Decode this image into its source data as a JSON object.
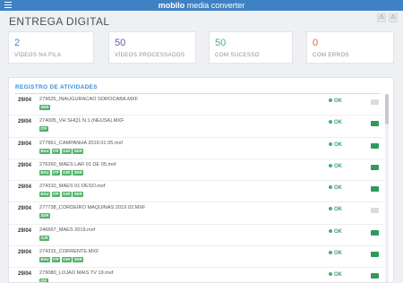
{
  "header": {
    "brand_bold": "mobilo",
    "brand_rest": " media converter"
  },
  "page_title": "ENTREGA DIGITAL",
  "stats": [
    {
      "value": "2",
      "label": "VÍDEOS NA FILA"
    },
    {
      "value": "50",
      "label": "VÍDEOS PROCESSADOS"
    },
    {
      "value": "50",
      "label": "COM SUCESSO"
    },
    {
      "value": "0",
      "label": "COM ERROS"
    }
  ],
  "activity": {
    "title": "REGISTRO DE ATIVIDADES",
    "rows": [
      {
        "date": "29/04",
        "file": "279625_INAUGURACAO SOROCABA.MXF",
        "tags": [
          "SDR"
        ],
        "status": "OK",
        "action_enabled": false
      },
      {
        "date": "29/04",
        "file": "274005_VH SHQ1 N.1 (NEUSA).MXF",
        "tags": [
          "ITP"
        ],
        "status": "OK",
        "action_enabled": true
      },
      {
        "date": "29/04",
        "file": "277861_CAMPANHA 2019 01 05.mxf",
        "tags": [
          "BAU",
          "ITP",
          "SJR",
          "SDR"
        ],
        "status": "OK",
        "action_enabled": true
      },
      {
        "date": "29/04",
        "file": "276260_MAES LAR 01 DE 05.mxf",
        "tags": [
          "BAU",
          "ITP",
          "SJR",
          "SDR"
        ],
        "status": "OK",
        "action_enabled": true
      },
      {
        "date": "29/04",
        "file": "274310_MAES 01 DESO.mxf",
        "tags": [
          "BAU",
          "ITP",
          "SJR",
          "SDR"
        ],
        "status": "OK",
        "action_enabled": true
      },
      {
        "date": "29/04",
        "file": "277738_CORDEIRO MAQUINAS 2019 02.MXF",
        "tags": [
          "SDR"
        ],
        "status": "OK",
        "action_enabled": false
      },
      {
        "date": "29/04",
        "file": "246667_MAES 2019.mxf",
        "tags": [
          "SJR"
        ],
        "status": "OK",
        "action_enabled": true
      },
      {
        "date": "29/04",
        "file": "274315_CORRENTE.MXF",
        "tags": [
          "BAU",
          "ITP",
          "SJR",
          "SDR"
        ],
        "status": "OK",
        "action_enabled": true
      },
      {
        "date": "29/04",
        "file": "279080_LOJAO MAIS TV 19.mxf",
        "tags": [
          "ITP"
        ],
        "status": "OK",
        "action_enabled": true
      }
    ]
  }
}
